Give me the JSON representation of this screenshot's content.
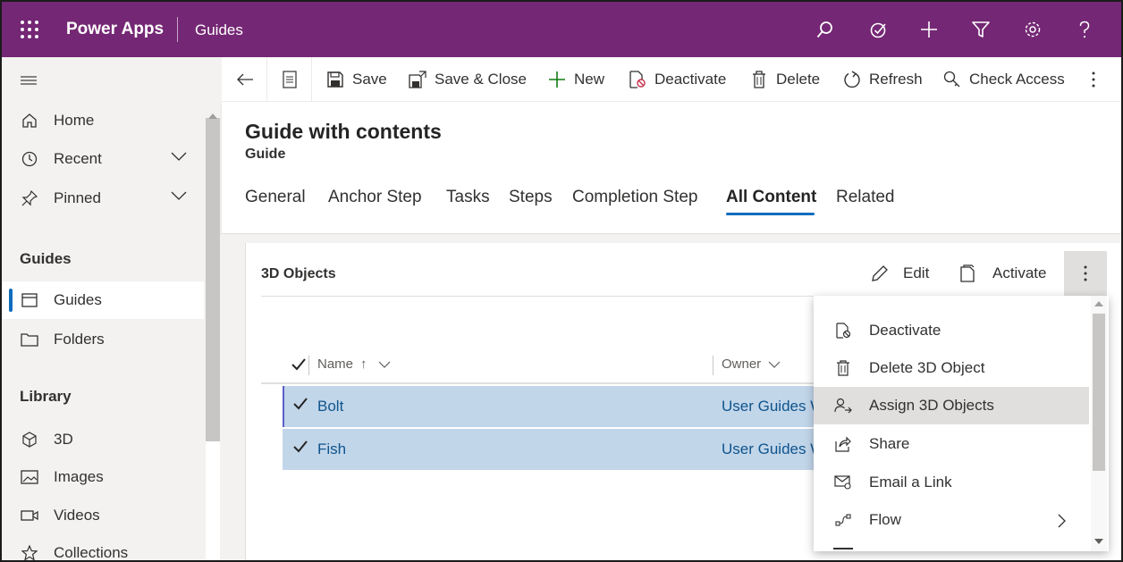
{
  "topbar": {
    "app_name": "Power Apps",
    "area_name": "Guides",
    "color": "#742774",
    "icons": [
      "search-icon",
      "task-icon",
      "plus-icon",
      "filter-icon",
      "settings-icon",
      "help-icon"
    ]
  },
  "sidebar": {
    "items": [
      {
        "label": "Home",
        "icon": "home-icon"
      },
      {
        "label": "Recent",
        "icon": "clock-icon"
      },
      {
        "label": "Pinned",
        "icon": "pin-icon"
      }
    ],
    "groups": [
      {
        "title": "Guides",
        "items": [
          {
            "label": "Guides",
            "icon": "form-icon"
          },
          {
            "label": "Folders",
            "icon": "folder-icon"
          }
        ]
      },
      {
        "title": "Library",
        "items": [
          {
            "label": "3D",
            "icon": "cube-icon"
          },
          {
            "label": "Images",
            "icon": "image-icon"
          },
          {
            "label": "Videos",
            "icon": "video-icon"
          },
          {
            "label": "Collections",
            "icon": "star-icon"
          }
        ]
      }
    ]
  },
  "commandbar": {
    "save": "Save",
    "save_close": "Save & Close",
    "new": "New",
    "deactivate": "Deactivate",
    "delete": "Delete",
    "refresh": "Refresh",
    "check_access": "Check Access"
  },
  "record": {
    "title": "Guide with contents",
    "type": "Guide",
    "tabs": [
      "General",
      "Anchor Step",
      "Tasks",
      "Steps",
      "Completion Step",
      "All Content",
      "Related"
    ],
    "active_tab": "All Content"
  },
  "subgrid": {
    "title": "3D Objects",
    "edit": "Edit",
    "activate": "Activate",
    "columns": {
      "name": "Name",
      "sort": "↑",
      "owner": "Owner"
    },
    "rows": [
      {
        "name": "Bolt",
        "owner": "User Guides W"
      },
      {
        "name": "Fish",
        "owner": "User Guides W"
      }
    ]
  },
  "menu": {
    "items": [
      {
        "label": "Deactivate",
        "icon": "deactivate-icon"
      },
      {
        "label": "Delete 3D Object",
        "icon": "delete-icon"
      },
      {
        "label": "Assign 3D Objects",
        "icon": "assign-icon"
      },
      {
        "label": "Share",
        "icon": "share-icon"
      },
      {
        "label": "Email a Link",
        "icon": "email-link-icon"
      },
      {
        "label": "Flow",
        "icon": "flow-icon"
      }
    ],
    "hovered": "Assign 3D Objects"
  },
  "colors": {
    "accent": "#0f6cbd",
    "selected_row": "#c2d6ea",
    "link": "#0f548c"
  }
}
